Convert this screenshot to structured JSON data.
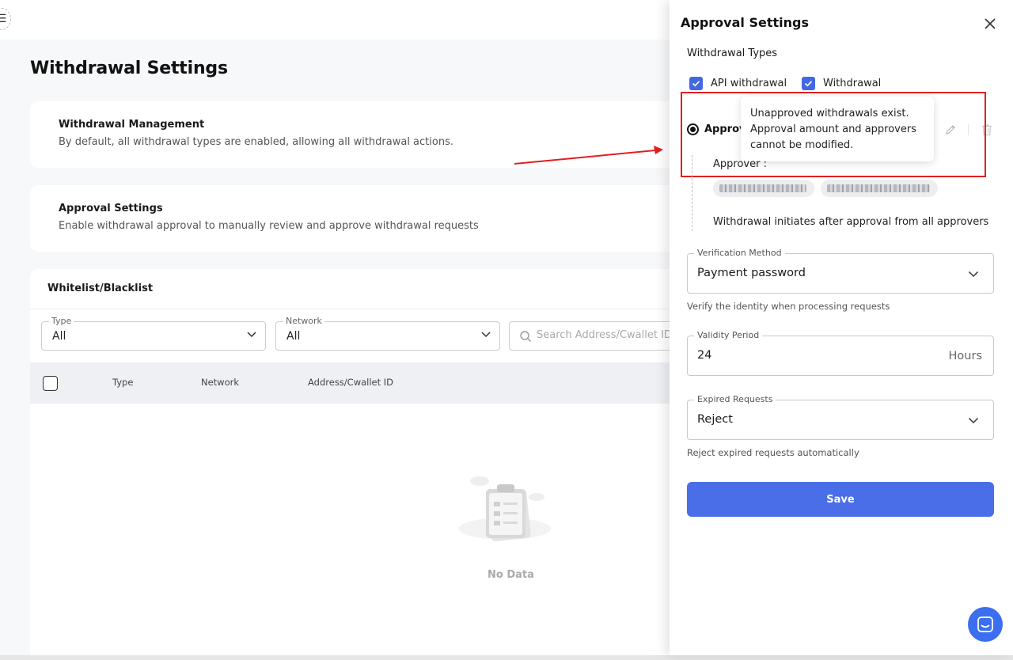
{
  "main": {
    "title": "Withdrawal Settings",
    "cards": [
      {
        "title": "Withdrawal Management",
        "desc": "By default, all withdrawal types are enabled, allowing all withdrawal actions."
      },
      {
        "title": "Approval Settings",
        "desc": "Enable withdrawal approval to manually review and approve withdrawal requests"
      }
    ],
    "whitelist": {
      "title": "Whitelist/Blacklist",
      "filters": {
        "type": {
          "label": "Type",
          "value": "All"
        },
        "network": {
          "label": "Network",
          "value": "All"
        },
        "search_placeholder": "Search Address/Cwallet ID"
      },
      "columns": [
        "Type",
        "Network",
        "Address/Cwallet ID"
      ],
      "empty_text": "No Data"
    }
  },
  "drawer": {
    "title": "Approval Settings",
    "withdrawal_types_title": "Withdrawal Types",
    "types": [
      {
        "label": "API withdrawal",
        "checked": true
      },
      {
        "label": "Withdrawal",
        "checked": true
      }
    ],
    "approval_rule_label": "Approv",
    "tooltip": {
      "line1": "Unapproved withdrawals exist.",
      "line2": "Approval amount and approvers",
      "line3": "cannot be modified."
    },
    "approver_label": "Approver :",
    "approval_note": "Withdrawal initiates after approval from all approvers",
    "verification": {
      "label": "Verification Method",
      "value": "Payment password",
      "helper": "Verify the identity when processing requests"
    },
    "validity": {
      "label": "Validity Period",
      "value": "24",
      "suffix": "Hours"
    },
    "expired": {
      "label": "Expired Requests",
      "value": "Reject",
      "helper": "Reject expired requests automatically"
    },
    "save_label": "Save"
  },
  "colors": {
    "accent": "#4a6ee8",
    "checkbox": "#4169e1",
    "highlight": "#e02020",
    "chat": "#3b6ff0"
  },
  "icons": [
    "menu-icon",
    "chevron-down-icon",
    "search-icon",
    "close-icon",
    "check-icon",
    "pencil-icon",
    "trash-icon",
    "chat-icon",
    "clipboard-icon"
  ]
}
